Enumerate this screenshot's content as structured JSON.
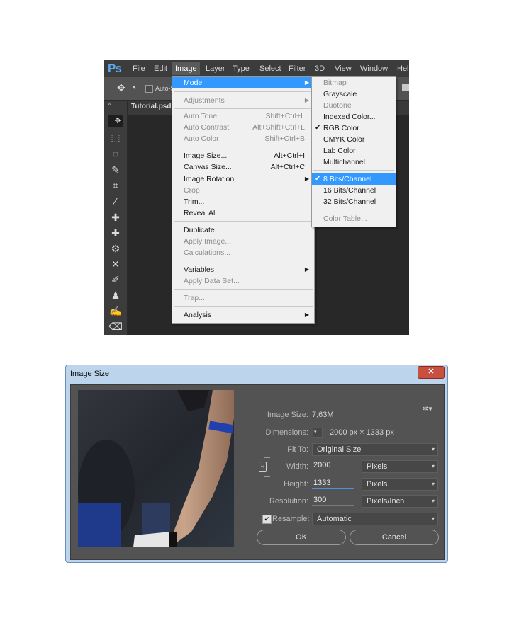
{
  "photoshop": {
    "logo": "Ps",
    "menubar": [
      "File",
      "Edit",
      "Image",
      "Layer",
      "Type",
      "Select",
      "Filter",
      "3D",
      "View",
      "Window",
      "Hel"
    ],
    "active_menu": "Image",
    "options": {
      "auto_label": "Auto-S"
    },
    "tab_title": "Tutorial.psd",
    "toolbar_tools": [
      "move-icon",
      "marquee-icon",
      "lasso-icon",
      "quick-select-icon",
      "crop-icon",
      "eyedropper-icon",
      "spot-heal-icon",
      "brush-heal-icon",
      "stamp-pattern-icon",
      "content-move-icon",
      "brush-icon",
      "clone-stamp-icon",
      "history-brush-icon",
      "eraser-icon"
    ],
    "image_menu": {
      "mode": "Mode",
      "adjustments": "Adjustments",
      "auto_tone": "Auto Tone",
      "auto_tone_sc": "Shift+Ctrl+L",
      "auto_contrast": "Auto Contrast",
      "auto_contrast_sc": "Alt+Shift+Ctrl+L",
      "auto_color": "Auto Color",
      "auto_color_sc": "Shift+Ctrl+B",
      "image_size": "Image Size...",
      "image_size_sc": "Alt+Ctrl+I",
      "canvas_size": "Canvas Size...",
      "canvas_size_sc": "Alt+Ctrl+C",
      "image_rotation": "Image Rotation",
      "crop": "Crop",
      "trim": "Trim...",
      "reveal_all": "Reveal All",
      "duplicate": "Duplicate...",
      "apply_image": "Apply Image...",
      "calculations": "Calculations...",
      "variables": "Variables",
      "apply_data_set": "Apply Data Set...",
      "trap": "Trap...",
      "analysis": "Analysis"
    },
    "mode_submenu": {
      "bitmap": "Bitmap",
      "grayscale": "Grayscale",
      "duotone": "Duotone",
      "indexed": "Indexed Color...",
      "rgb": "RGB Color",
      "cmyk": "CMYK Color",
      "lab": "Lab Color",
      "multichannel": "Multichannel",
      "bits8": "8 Bits/Channel",
      "bits16": "16 Bits/Channel",
      "bits32": "32 Bits/Channel",
      "color_table": "Color Table...",
      "check": "✔"
    }
  },
  "dialog": {
    "title": "Image Size",
    "close": "✕",
    "image_size_label": "Image Size:",
    "image_size_value": "7,63M",
    "dimensions_label": "Dimensions:",
    "dimensions_value": "2000 px  ×  1333 px",
    "fit_to_label": "Fit To:",
    "fit_to_value": "Original Size",
    "width_label": "Width:",
    "width_value": "2000",
    "width_unit": "Pixels",
    "height_label": "Height:",
    "height_value": "1333",
    "height_unit": "Pixels",
    "resolution_label": "Resolution:",
    "resolution_value": "300",
    "resolution_unit": "Pixels/Inch",
    "resample_label": "Resample:",
    "resample_checked": "✔",
    "resample_value": "Automatic",
    "ok": "OK",
    "cancel": "Cancel"
  }
}
